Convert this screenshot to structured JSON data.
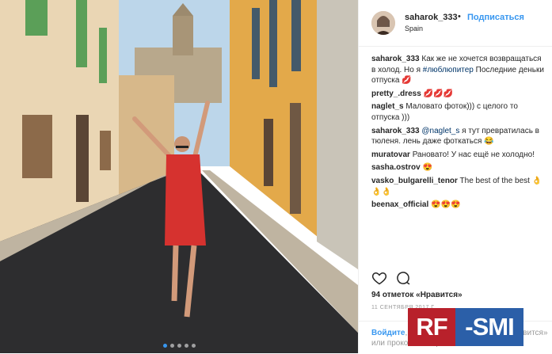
{
  "header": {
    "username": "saharok_333",
    "separator": "•",
    "follow_label": "Подписаться",
    "location": "Spain"
  },
  "comments": [
    {
      "user": "saharok_333",
      "text": "Как же не хочется возвращаться в холод. Но я ",
      "tag": "#люблюпитер",
      "rest": " Последние деньки отпуска 💋"
    },
    {
      "user": "pretty_.dress",
      "text": "💋💋💋"
    },
    {
      "user": "naglet_s",
      "text": "Маловато фоток))) с целого то отпуска )))"
    },
    {
      "user": "saharok_333",
      "mention": "@naglet_s",
      "text": " я тут превратилась в тюленя. лень даже фоткаться 😂"
    },
    {
      "user": "muratovar",
      "text": "Рановато! У нас ещё не холодно!"
    },
    {
      "user": "sasha.ostrov",
      "text": "😍"
    },
    {
      "user": "vasko_bulgarelli_tenor",
      "text": "The best of the best 👌👌👌"
    },
    {
      "user": "beenax_official",
      "text": "😍😍😍"
    }
  ],
  "likes_text": "94 отметок «Нравится»",
  "date": "11 СЕНТЯБРЯ 2017 Г.",
  "login": {
    "link": "Войдите",
    "text": ", чтобы поставить отметку «Нравится»",
    "line2": "или прокомментировать."
  },
  "watermark": {
    "left": "RF",
    "right": "-SMI"
  },
  "icons": [
    "heart-icon",
    "comment-icon"
  ],
  "carousel": {
    "count": 5,
    "active_index": 0
  },
  "colors": {
    "link": "#3897f0",
    "text": "#262626",
    "muted": "#999999",
    "watermark_red": "#b8212b",
    "watermark_blue": "#2b5fa8"
  }
}
